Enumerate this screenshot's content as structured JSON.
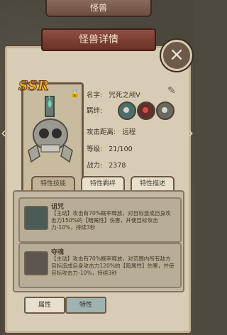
{
  "header": {
    "top_title": "怪兽",
    "title": "怪兽详情"
  },
  "card": {
    "rarity": "SSR",
    "count": "x0"
  },
  "info": {
    "name_label": "名字:",
    "name_value": "咒死之颅V",
    "bond_label": "羁绊:",
    "range_label": "攻击距离:",
    "range_value": "远程",
    "level_label": "等级:",
    "level_value": "21/100",
    "power_label": "战力:",
    "power_value": "2378"
  },
  "tabs": [
    "特性技能",
    "特性羁绊",
    "特性描述"
  ],
  "skills": [
    {
      "name": "诅咒",
      "desc": "【主动】攻击有70%概率释放，对目标造成自身攻击力150%的【暗属性】伤害，并使目标攻击力-10%，持续3秒"
    },
    {
      "name": "夺魂",
      "desc": "【主动】攻击有70%概率释放，对范围内所有敌方目标造成自身攻击力120%的【暗属性】伤害，并使目标攻击力-10%，持续3秒"
    }
  ],
  "bottom": {
    "attr_label": "属性",
    "trait_label": "特性"
  }
}
